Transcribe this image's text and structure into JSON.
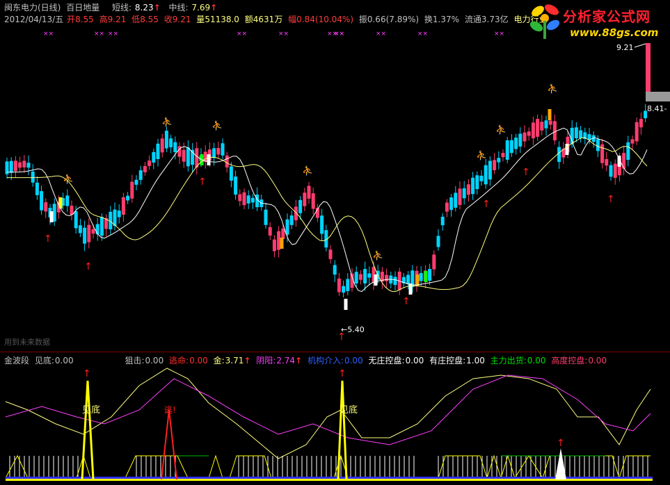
{
  "header": {
    "title": "闽东电力(日线)",
    "indicator_name": "百日地量",
    "short_label": "短线:",
    "short_value": "8.23",
    "mid_label": "中线:",
    "mid_value": "7.69",
    "up_glyph": "↑"
  },
  "ohlc": {
    "date": "2012/04/13/五",
    "open_label": "开",
    "open": "8.55",
    "high_label": "高",
    "high": "9.21",
    "low_label": "低",
    "low": "8.55",
    "close_label": "收",
    "close": "9.21",
    "volume_label": "量",
    "volume": "51138.0",
    "amount_label": "额",
    "amount": "4631万",
    "change_label": "幅",
    "change": "0.84(10.04%)",
    "amplitude_label": "振",
    "amplitude": "0.66(7.89%)",
    "turnover_label": "换",
    "turnover": "1.37%",
    "float_label": "流通",
    "float": "3.73亿",
    "industry": "电力行业"
  },
  "logo": {
    "brand": "分析家公式网",
    "url": "www.88gs.com"
  },
  "price_chart": {
    "max_label": "9.21",
    "min_label": "←5.40",
    "right_label": "8.41-",
    "future_data_note": "用到未来数据"
  },
  "indicator_bar": {
    "name": "金波段",
    "bottom_label": "见底:",
    "bottom_value": "0.00",
    "snipe_label": "狙击:",
    "snipe_value": "0.00",
    "escape_label": "逃命:",
    "escape_value": "0.00",
    "gold_label": "金:",
    "gold_value": "3.71",
    "yinyang_label": "阴阳:",
    "yinyang_value": "2.74",
    "inst_label": "机构介入:",
    "inst_value": "0.00",
    "nodealer_label": "无庄控盘:",
    "nodealer_value": "0.00",
    "dealer_label": "有庄控盘:",
    "dealer_value": "1.00",
    "main_label": "主力出货:",
    "main_value": "0.00",
    "high_label": "高度控盘:",
    "high_value": "0.00"
  },
  "annotations": {
    "bottom_text": "见底",
    "escape_text": "逃!",
    "runner_glyph": "⛹",
    "cross_glyph": "××"
  },
  "colors": {
    "up": "#ff3c6e",
    "down": "#00d4ff",
    "ma_short": "#ffffff",
    "ma_mid": "#ffff80",
    "signal_red": "#ff2020",
    "magenta": "#ff40ff",
    "yellow": "#ffff00",
    "green": "#00c000",
    "orange": "#ffa500"
  }
}
